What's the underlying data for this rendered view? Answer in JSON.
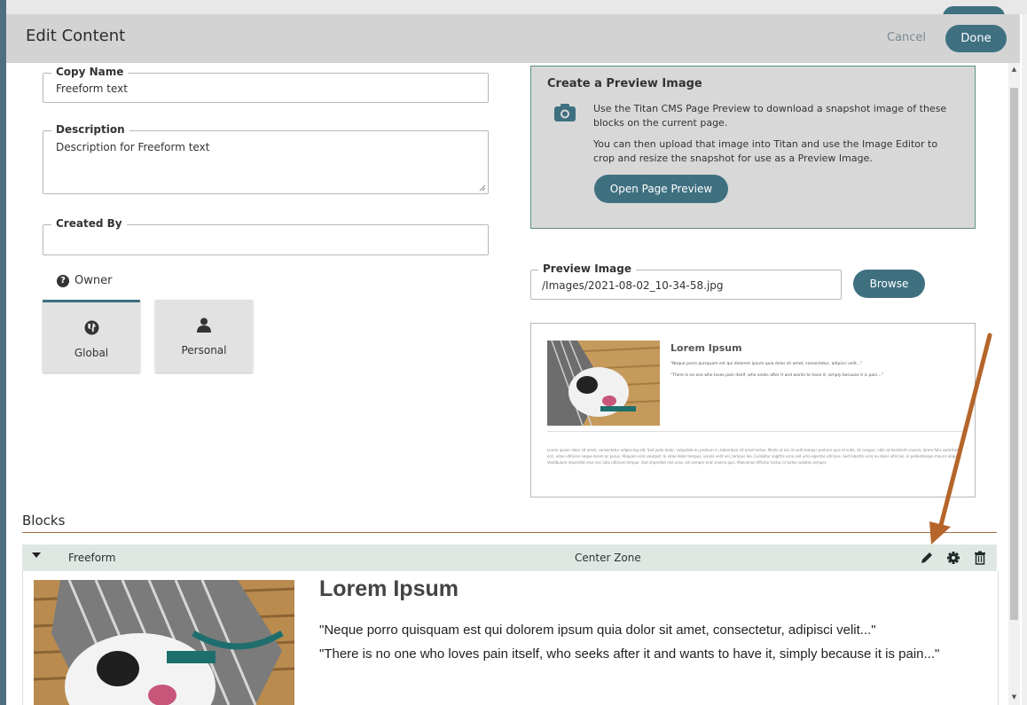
{
  "dialog": {
    "title": "Edit Content",
    "cancel_label": "Cancel",
    "done_label": "Done"
  },
  "fields": {
    "copy_name": {
      "label": "Copy Name",
      "value": "Freeform text"
    },
    "description": {
      "label": "Description",
      "value": "Description for Freeform text"
    },
    "created_by": {
      "label": "Created By",
      "value": ""
    },
    "preview_image": {
      "label": "Preview Image",
      "value": "/Images/2021-08-02_10-34-58.jpg"
    }
  },
  "owner": {
    "label": "Owner",
    "options": [
      {
        "label": "Global",
        "icon": "globe-icon",
        "selected": true
      },
      {
        "label": "Personal",
        "icon": "user-icon",
        "selected": false
      }
    ]
  },
  "preview_panel": {
    "title": "Create a Preview Image",
    "text1": "Use the Titan CMS Page Preview to download a snapshot image of these blocks on the current page.",
    "text2": "You can then upload that image into Titan and use the Image Editor to crop and resize the snapshot for use as a Preview Image.",
    "button_label": "Open Page Preview",
    "icon": "camera-icon"
  },
  "browse_label": "Browse",
  "thumbnail": {
    "title": "Lorem Ipsum",
    "quote1": "\"Neque porro quisquam est qui dolorem ipsum quia dolor sit amet, consectetur, adipisci velit...\"",
    "quote2": "\"There is no one who loves pain itself, who seeks after it and wants to have it, simply because it is pain...\"",
    "paragraph": "Lorem ipsum dolor sit amet, consectetur adipiscing elit. Sed justo dolor, vulputate eu pretium in, bibendum sit amet lectus. Morbi ut nisi id velit tempor pretium quis id nulla. Ut congue, nibh at hendrerit viverra, lorem felis sollicitudin orci, vitae ultricies neque lorem ac purus. Aliquam erat volutpat. In vitae dolor tempus, iaculis velit vel, tempus leo. Curabitur sagittis urna sed urna egestas ultricies. Sed lobortis urna eu dolor ultricies, in pellentesque mauris aliquet. Vestibulum imperdiet eros nec odio ultricies tempor. Sed imperdiet nisl urna, vel semper erat viverra quis. Maecenas efficitur lectus in tortor sodales semper."
  },
  "blocks": {
    "heading": "Blocks",
    "items": [
      {
        "type": "Freeform",
        "zone": "Center Zone",
        "tools": [
          "edit-icon",
          "settings-icon",
          "trash-icon"
        ],
        "title": "Lorem Ipsum",
        "quote1": "\"Neque porro quisquam est qui dolorem ipsum quia dolor sit amet, consectetur, adipisci velit...\"",
        "quote2": "\"There is no one who loves pain itself, who seeks after it and wants to have it, simply because it is pain...\""
      }
    ]
  },
  "colors": {
    "accent": "#3e7080",
    "annotation_arrow": "#b5652a",
    "block_header_bg": "#dfe7e3",
    "preview_panel_bg": "#d8d8d8"
  }
}
